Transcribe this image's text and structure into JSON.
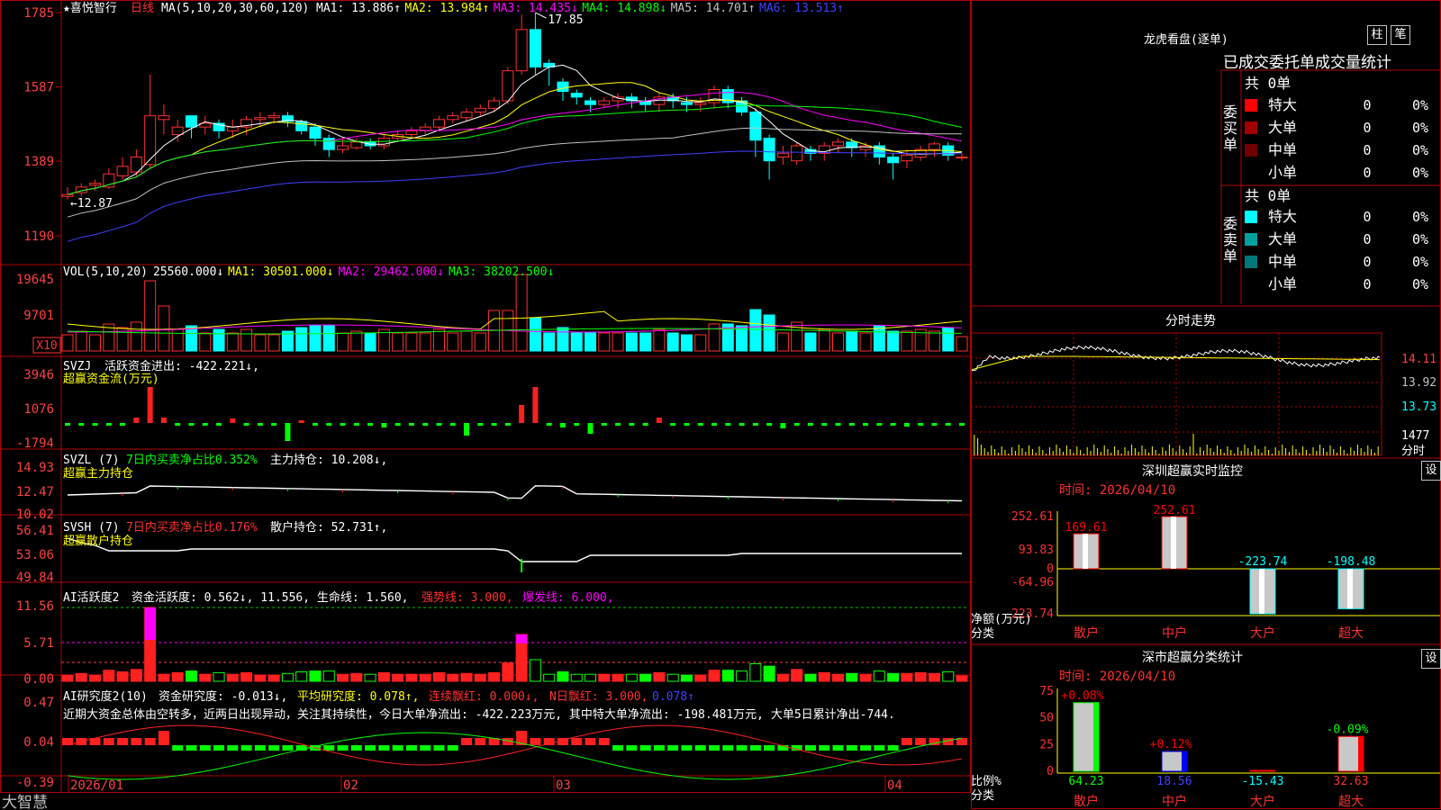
{
  "stock": {
    "name": "喜悦智行",
    "period": "日线",
    "ma_label": "MA(5,10,20,30,60,120)",
    "ma_items": [
      {
        "text": "MA1: 13.886↑",
        "color": "#ffffff"
      },
      {
        "text": "MA2: 13.984↑",
        "color": "#ffff00"
      },
      {
        "text": "MA3: 14.435↓",
        "color": "#ff00ff"
      },
      {
        "text": "MA4: 14.898↓",
        "color": "#00ff00"
      },
      {
        "text": "MA5: 14.701↑",
        "color": "#c0c0c0"
      },
      {
        "text": "MA6: 13.513↑",
        "color": "#4040ff"
      }
    ],
    "high_mark": "17.85",
    "low_mark": "12.87"
  },
  "vol_panel": {
    "label": "VOL(5,10,20)",
    "items": [
      {
        "text": "25560.000↓",
        "color": "#ffffff"
      },
      {
        "text": "MA1: 30501.000↓",
        "color": "#ffff00"
      },
      {
        "text": "MA2: 29462.000↓",
        "color": "#ff00ff"
      },
      {
        "text": "MA3: 38202.500↓",
        "color": "#00ff00"
      }
    ],
    "unit_badge": "X10",
    "axis": [
      "19645",
      "9701"
    ]
  },
  "svzj_panel": {
    "label": "SVZJ",
    "value_text": "活跃资金进出: -422.221↓,",
    "title": "超赢资金流(万元)",
    "axis": [
      "3946",
      "1076",
      "-1794"
    ]
  },
  "svzl_panel": {
    "label": "SVZL (7)",
    "ratio_text": "7日内买卖净占比0.352%",
    "hold_text": "主力持仓: 10.208↓,",
    "title": "超赢主力持仓",
    "axis": [
      "14.93",
      "12.47",
      "10.02"
    ]
  },
  "svsh_panel": {
    "label": "SVSH (7)",
    "ratio_text": "7日内买卖净占比0.176%",
    "hold_text": "散户持仓: 52.731↑,",
    "title": "超赢散户持仓",
    "axis": [
      "56.41",
      "53.06",
      "49.84"
    ]
  },
  "ai_active_panel": {
    "label": "AI活跃度2",
    "value_text": "资金活跃度: 0.562↓, 11.556, 生命线: 1.560,",
    "strong_text": "强势线: 3.000,",
    "burst_text": "爆发线: 6.000,",
    "axis": [
      "11.56",
      "5.71",
      "0.00"
    ]
  },
  "ai_research_panel": {
    "label": "AI研究度2(10)",
    "value_text": "资金研究度: -0.013↓,",
    "avg_text": "平均研究度: 0.078↑,",
    "red_text": "连续飘红: 0.000↓,",
    "nday_text": "N日飘红: 3.000,",
    "last_text": "0.078↑",
    "comment": "近期大资金总体由空转多，近两日出现异动，关注其持续性，今日大单净流出: -422.223万元, 其中特大单净流出: -198.481万元, 大单5日累计净出-744.",
    "axis": [
      "0.47",
      "0.04",
      "-0.39"
    ]
  },
  "date_axis": [
    "2026/01",
    "02",
    "03",
    "04"
  ],
  "brand": "大智慧",
  "price_axis": [
    "1785",
    "1587",
    "1389",
    "1190"
  ],
  "dragon_tiger": {
    "title": "龙虎看盘(逐单)",
    "btn_bar": "柱",
    "btn_pen": "笔",
    "header": "已成交委托单成交量统计",
    "buy_label": "委买单",
    "sell_label": "委卖单",
    "buy_total": "共 0单",
    "sell_total": "共 0单",
    "buy_rows": [
      {
        "name": "特大",
        "count": "0",
        "pct": "0%",
        "color": "#ff0000"
      },
      {
        "name": "大单",
        "count": "0",
        "pct": "0%",
        "color": "#a00000"
      },
      {
        "name": "中单",
        "count": "0",
        "pct": "0%",
        "color": "#700000"
      },
      {
        "name": "小单",
        "count": "0",
        "pct": "0%",
        "color": ""
      }
    ],
    "sell_rows": [
      {
        "name": "特大",
        "count": "0",
        "pct": "0%",
        "color": "#00ffff"
      },
      {
        "name": "大单",
        "count": "0",
        "pct": "0%",
        "color": "#00a0a0"
      },
      {
        "name": "中单",
        "count": "0",
        "pct": "0%",
        "color": "#007878"
      },
      {
        "name": "小单",
        "count": "0",
        "pct": "0%",
        "color": ""
      }
    ]
  },
  "intraday": {
    "title": "分时走势",
    "axis": [
      "14.11",
      "13.92",
      "13.73"
    ],
    "vol_axis": "1477",
    "vol_label": "分时"
  },
  "sz_monitor": {
    "title": "深圳超赢实时监控",
    "btn": "设",
    "date": "时间: 2026/04/10",
    "axis": [
      "252.61",
      "93.83",
      "0",
      "-64.96",
      "-223.74"
    ],
    "ylabel": "净额(万元)",
    "xlabel": "分类",
    "bars": [
      {
        "cat": "散户",
        "value": 169.61,
        "label": "169.61",
        "color": "#ff0000"
      },
      {
        "cat": "中户",
        "value": 252.61,
        "label": "252.61",
        "color": "#ff0000"
      },
      {
        "cat": "大户",
        "value": -223.74,
        "label": "-223.74",
        "color": "#00ffff"
      },
      {
        "cat": "超大",
        "value": -198.48,
        "label": "-198.48",
        "color": "#00ffff"
      }
    ]
  },
  "sz_category": {
    "title": "深市超赢分类统计",
    "btn": "设",
    "date": "时间: 2026/04/10",
    "axis": [
      "75",
      "50",
      "25",
      "0"
    ],
    "ylabel": "比例%",
    "xlabel": "分类",
    "bars": [
      {
        "cat": "散户",
        "value": 64.23,
        "label": "64.23",
        "top": "+0.08%",
        "top_color": "#ff0000",
        "color": "#00ff00"
      },
      {
        "cat": "中户",
        "value": 18.56,
        "label": "18.56",
        "top": "+0.12%",
        "top_color": "#ff0000",
        "color": "#0000ff"
      },
      {
        "cat": "大户",
        "value": -15.43,
        "label": "-15.43",
        "top": "",
        "top_color": "#ffffff",
        "color": "#ff0000"
      },
      {
        "cat": "超大",
        "value": 32.63,
        "label": "32.63",
        "top": "-0.09%",
        "top_color": "#00ff00",
        "color": "#ff0000"
      }
    ]
  },
  "chart_data": {
    "type": "candlestick",
    "title": "喜悦智行 日线",
    "ylim": [
      11.9,
      17.9
    ],
    "x": [
      "2026/01",
      "",
      "",
      "",
      "",
      "",
      "",
      "",
      "",
      "",
      "",
      "",
      "",
      "",
      "",
      "",
      "",
      "",
      "02",
      "",
      "",
      "",
      "",
      "",
      "",
      "",
      "",
      "",
      "",
      "",
      "",
      "03",
      "",
      "",
      "",
      "",
      "",
      "",
      "",
      "",
      "",
      "",
      "",
      "",
      "",
      "",
      "",
      "",
      "",
      "",
      "",
      "",
      "",
      "",
      "",
      "",
      "",
      "",
      "04",
      "",
      "",
      "",
      "",
      "",
      ""
    ],
    "open": [
      12.95,
      13.05,
      13.25,
      13.2,
      13.5,
      13.6,
      13.8,
      15.0,
      14.6,
      15.1,
      14.8,
      14.9,
      14.7,
      14.8,
      15.0,
      15.05,
      15.1,
      14.95,
      14.8,
      14.5,
      14.2,
      14.25,
      14.4,
      14.3,
      14.5,
      14.6,
      14.7,
      14.8,
      15.0,
      15.05,
      15.2,
      15.3,
      15.5,
      16.3,
      17.4,
      16.5,
      16.0,
      15.7,
      15.5,
      15.4,
      15.5,
      15.6,
      15.5,
      15.4,
      15.6,
      15.45,
      15.4,
      15.45,
      15.8,
      15.5,
      15.2,
      14.5,
      14.0,
      13.9,
      14.2,
      14.1,
      14.3,
      14.4,
      14.2,
      14.3,
      14.0,
      13.9,
      14.0,
      14.2,
      14.3,
      14.0
    ],
    "close": [
      13.0,
      13.2,
      13.3,
      13.55,
      13.75,
      14.0,
      15.1,
      15.1,
      14.8,
      14.8,
      14.9,
      14.7,
      14.8,
      15.0,
      15.05,
      15.1,
      14.95,
      14.7,
      14.5,
      14.2,
      14.3,
      14.4,
      14.3,
      14.5,
      14.6,
      14.7,
      14.8,
      15.0,
      15.1,
      15.2,
      15.3,
      15.5,
      16.3,
      17.4,
      16.4,
      16.4,
      15.75,
      15.6,
      15.4,
      15.5,
      15.6,
      15.5,
      15.4,
      15.6,
      15.5,
      15.4,
      15.45,
      15.8,
      15.45,
      15.2,
      14.45,
      13.9,
      14.1,
      14.3,
      14.1,
      14.3,
      14.4,
      14.25,
      14.3,
      14.0,
      13.85,
      14.05,
      14.2,
      14.35,
      14.05,
      14.0
    ],
    "high": [
      13.2,
      13.3,
      13.4,
      13.7,
      14.0,
      14.2,
      16.2,
      15.4,
      15.0,
      15.1,
      15.1,
      15.0,
      15.0,
      15.1,
      15.2,
      15.2,
      15.2,
      15.0,
      14.9,
      14.6,
      14.5,
      14.5,
      14.5,
      14.6,
      14.7,
      14.8,
      14.9,
      15.1,
      15.2,
      15.3,
      15.4,
      15.6,
      16.4,
      17.8,
      17.85,
      16.6,
      16.1,
      15.8,
      15.6,
      15.6,
      15.7,
      15.7,
      15.6,
      15.7,
      15.7,
      15.6,
      15.6,
      15.9,
      15.9,
      15.6,
      15.3,
      14.6,
      14.3,
      14.4,
      14.3,
      14.4,
      14.5,
      14.5,
      14.4,
      14.4,
      14.1,
      14.2,
      14.3,
      14.4,
      14.4,
      14.1
    ],
    "low": [
      12.87,
      12.95,
      13.1,
      13.15,
      13.4,
      13.5,
      13.7,
      14.6,
      14.4,
      14.5,
      14.6,
      14.5,
      14.5,
      14.6,
      14.8,
      14.9,
      14.8,
      14.6,
      14.3,
      14.0,
      14.1,
      14.2,
      14.2,
      14.2,
      14.4,
      14.5,
      14.6,
      14.7,
      14.9,
      14.95,
      15.1,
      15.2,
      15.4,
      16.2,
      16.2,
      15.9,
      15.5,
      15.4,
      15.2,
      15.3,
      15.3,
      15.3,
      15.2,
      15.2,
      15.3,
      15.2,
      15.2,
      15.3,
      15.3,
      15.1,
      14.0,
      13.4,
      13.8,
      13.8,
      13.9,
      13.9,
      14.1,
      14.0,
      14.0,
      13.8,
      13.4,
      13.7,
      13.9,
      14.0,
      13.9,
      13.9
    ]
  }
}
